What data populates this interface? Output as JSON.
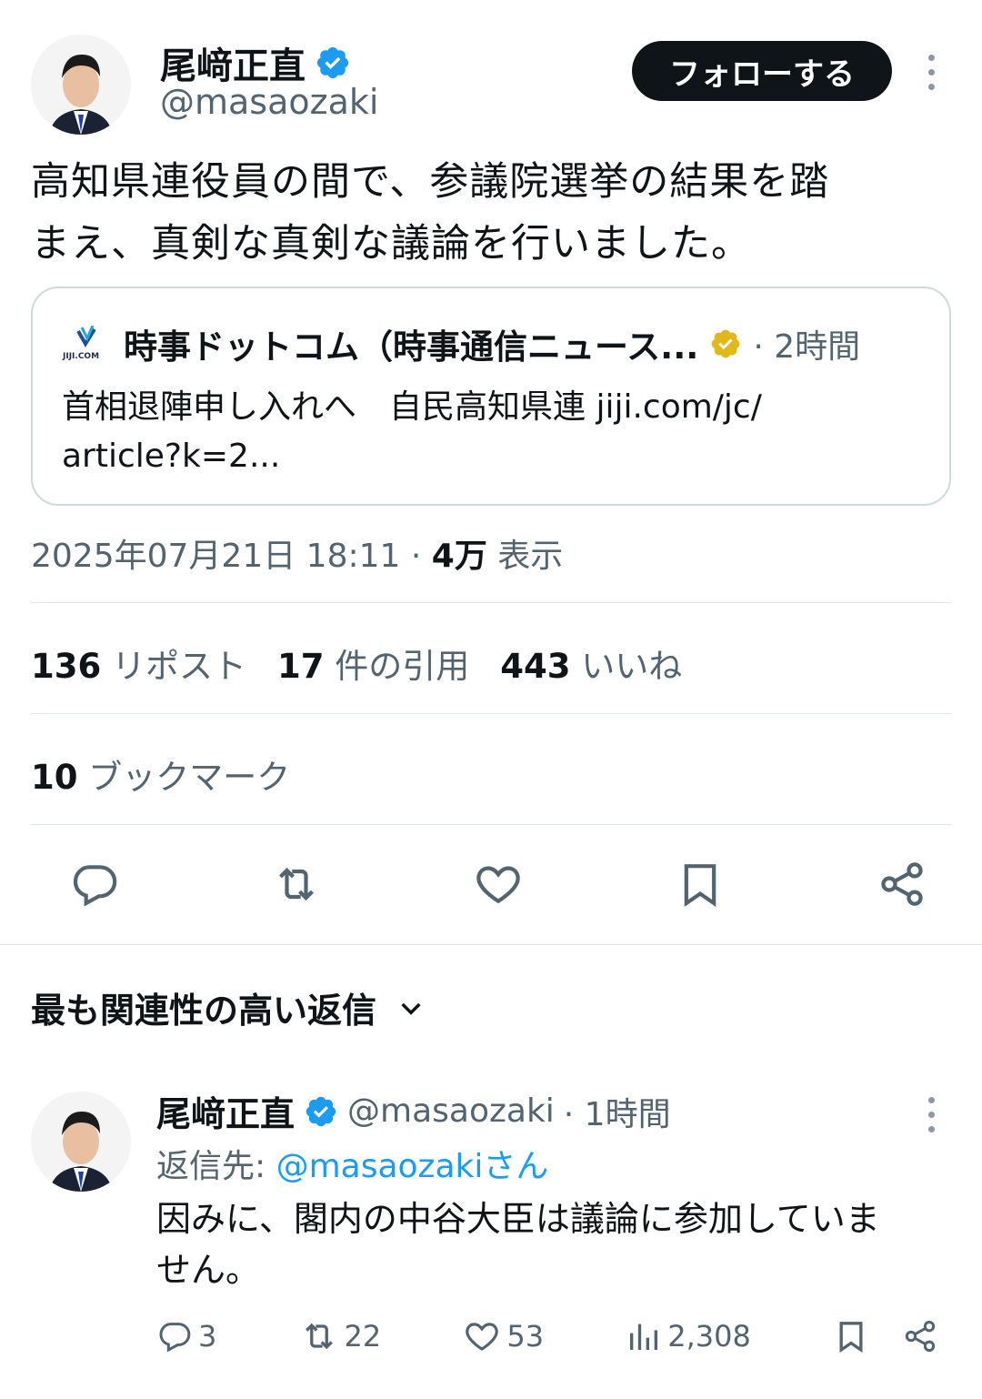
{
  "tweet": {
    "author_name": "尾﨑正直",
    "author_handle": "@masaozaki",
    "follow_label": "フォローする",
    "text_line1": "高知県連役員の間で、参議院選挙の結果を踏",
    "text_line2": "まえ、真剣な真剣な議論を行いました。",
    "quote": {
      "source_logo_text": "JIJI.COM",
      "source_name": "時事ドットコム（時事通信ニュース...",
      "time": "· 2時間",
      "text_line1": "首相退陣申し入れへ　自民高知県連 jiji.com/jc/",
      "text_line2": "article?k=2..."
    },
    "timestamp": "2025年07月21日 18:11 · ",
    "views_num": "4万",
    "views_label": " 表示",
    "stats": {
      "reposts_num": "136",
      "reposts_label": "リポスト",
      "quotes_num": "17",
      "quotes_label": "件の引用",
      "likes_num": "443",
      "likes_label": "いいね",
      "bookmarks_num": "10",
      "bookmarks_label": "ブックマーク"
    }
  },
  "replies_header": "最も関連性の高い返信",
  "reply": {
    "author_name": "尾﨑正直",
    "author_handle": "@masaozaki",
    "time": "· 1時間",
    "reply_to_prefix": "返信先: ",
    "reply_to_handle": "@masaozakiさん",
    "text_line1": "因みに、閣内の中谷大臣は議論に参加していま",
    "text_line2": "せん。",
    "counts": {
      "replies": "3",
      "reposts": "22",
      "likes": "53",
      "views": "2,308"
    }
  },
  "colors": {
    "verified_blue": "#1d9bf0",
    "verified_gold": "#e2b719",
    "text_primary": "#0f1419",
    "text_secondary": "#536471",
    "link": "#1d9bf0"
  }
}
